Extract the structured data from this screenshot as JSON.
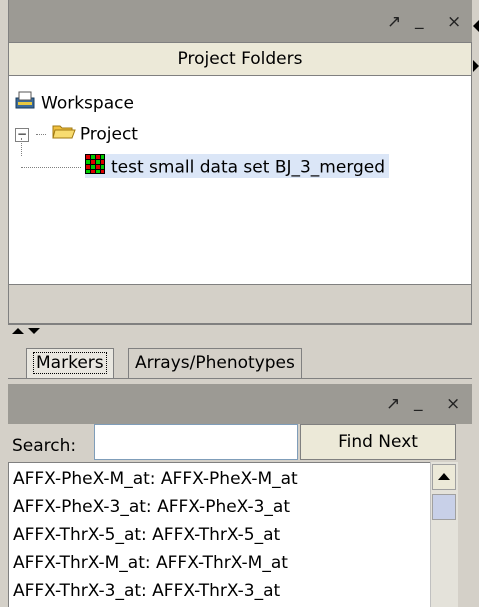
{
  "top_panel": {
    "controls": {
      "maximize": "↗",
      "minimize": "_",
      "close": "×"
    },
    "header_label": "Project Folders",
    "tree": [
      {
        "label": "Workspace",
        "icon": "workspace-icon"
      },
      {
        "label": "Project",
        "icon": "folder-open-icon",
        "expander": "−"
      },
      {
        "label": "test small data set BJ_3_merged",
        "icon": "heatmap-icon",
        "selected": true
      }
    ]
  },
  "tabs": [
    "Markers",
    "Arrays/Phenotypes"
  ],
  "bottom_panel": {
    "controls": {
      "maximize": "↗",
      "minimize": "_",
      "close": "×"
    },
    "search_label": "Search:",
    "search_value": "",
    "find_next_label": "Find Next",
    "list_items": [
      "AFFX-PheX-M_at: AFFX-PheX-M_at",
      "AFFX-PheX-3_at: AFFX-PheX-3_at",
      "AFFX-ThrX-5_at: AFFX-ThrX-5_at",
      "AFFX-ThrX-M_at: AFFX-ThrX-M_at",
      "AFFX-ThrX-3_at: AFFX-ThrX-3_at"
    ]
  },
  "colors": {
    "selection": "#dbe6f7",
    "titlebar": "#9c9a94"
  }
}
